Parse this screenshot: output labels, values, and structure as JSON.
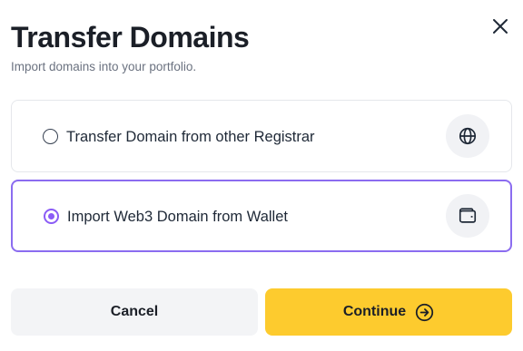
{
  "dialog": {
    "title": "Transfer Domains",
    "subtitle": "Import domains into your portfolio."
  },
  "options": [
    {
      "label": "Transfer Domain from other Registrar",
      "icon": "globe-icon",
      "selected": false
    },
    {
      "label": "Import Web3 Domain from Wallet",
      "icon": "wallet-icon",
      "selected": true
    }
  ],
  "actions": {
    "cancel_label": "Cancel",
    "continue_label": "Continue"
  },
  "colors": {
    "accent": "#8b5cf6",
    "primary_button": "#fdcb2e",
    "secondary_button": "#f3f4f6"
  }
}
